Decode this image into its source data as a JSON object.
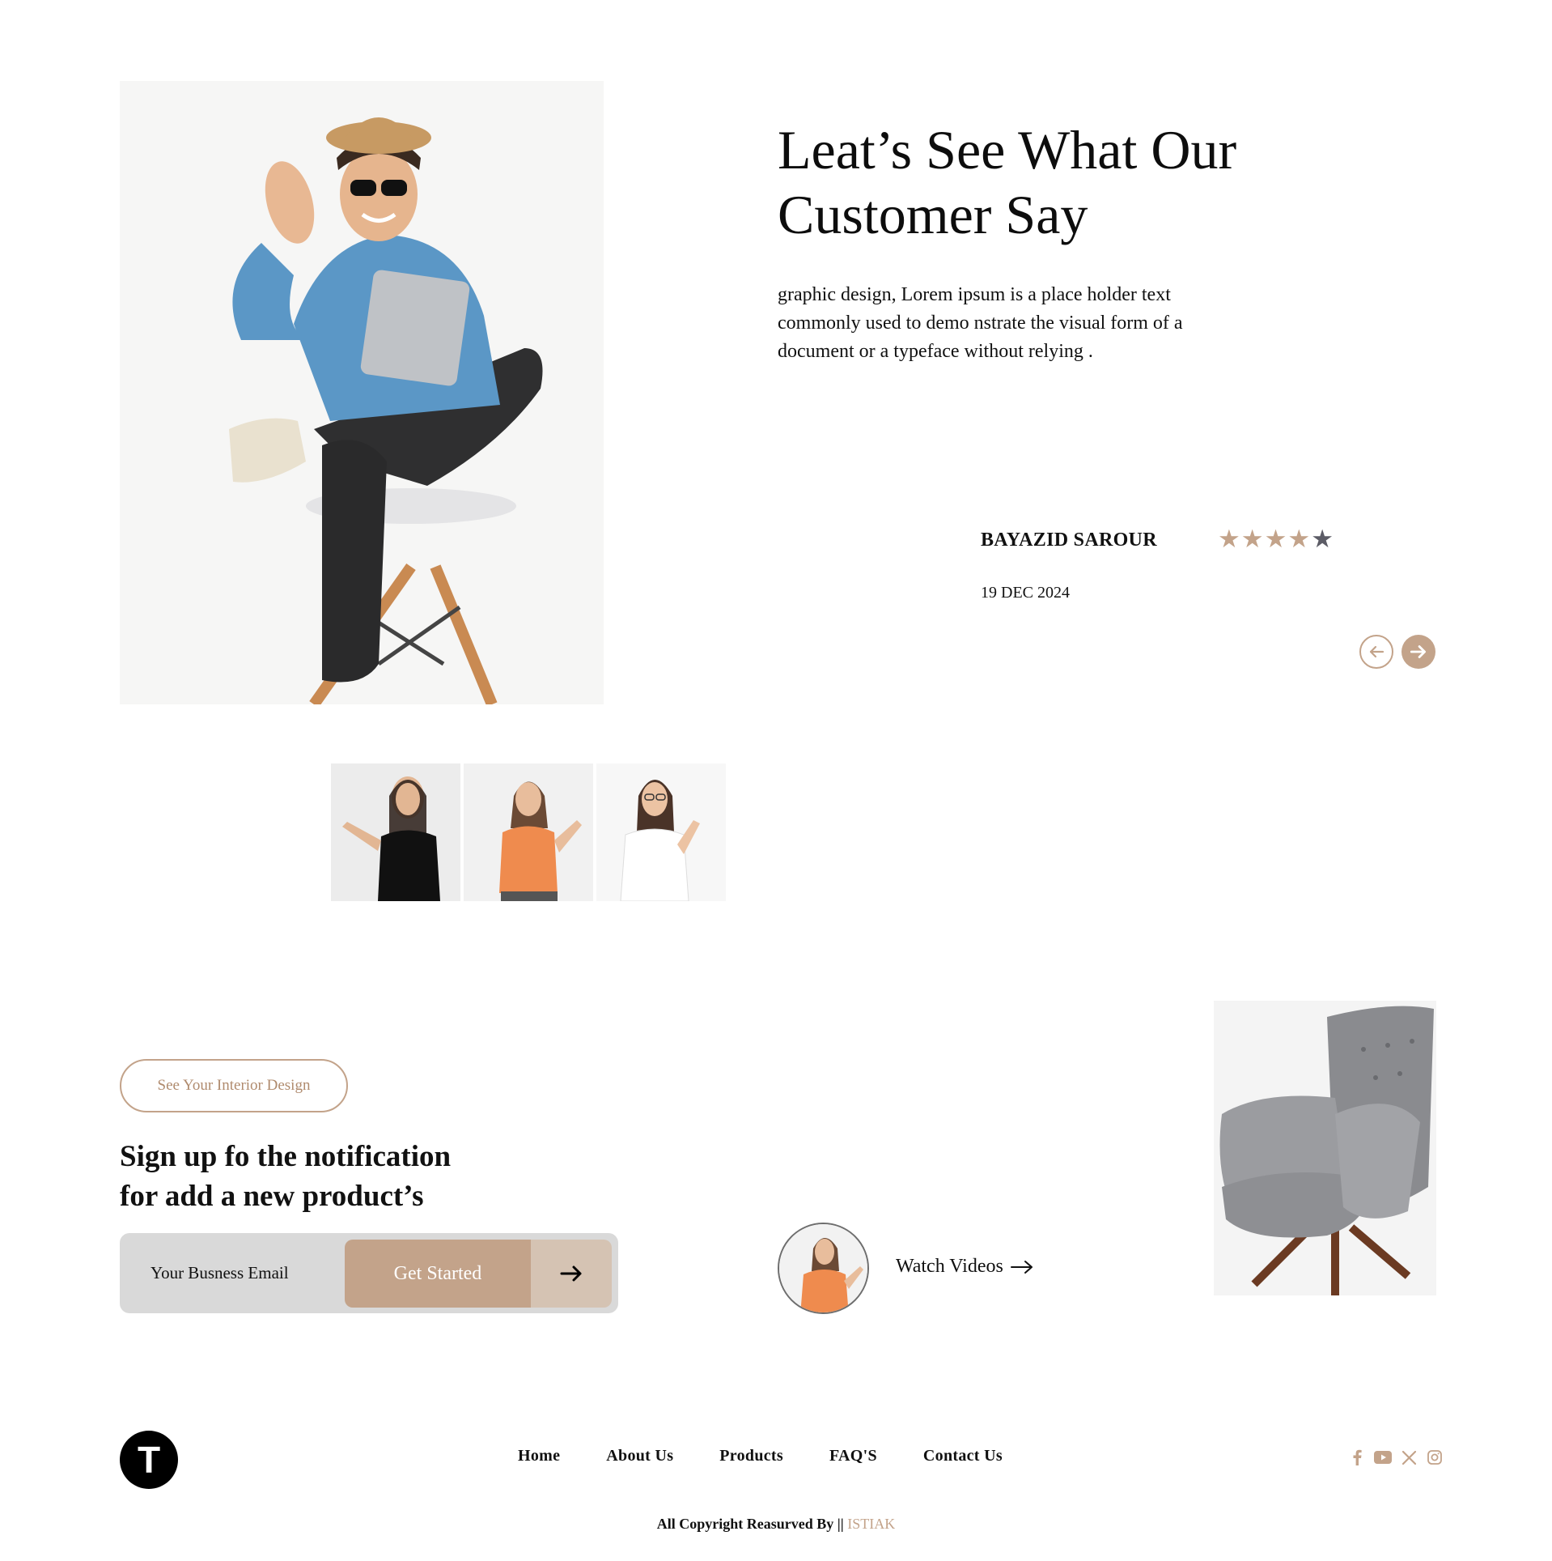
{
  "testimonial": {
    "heading_line1": "Leat’s See What Our",
    "heading_line2": "Customer Say",
    "intro": "graphic design, Lorem ipsum is a place holder text commonly used to demo nstrate the visual form of a document or a typeface without relying .",
    "reviewer_name": "BAYAZID SAROUR",
    "rating": 4,
    "rating_max": 5,
    "date": "19 DEC 2024",
    "star_glyph": "★",
    "star_color_filled": "#c3a38a",
    "star_color_empty": "#5c5c66"
  },
  "signup": {
    "pill_label": "See Your Interior Design",
    "title_line1": "Sign up fo the notification",
    "title_line2": "for add a new product’s",
    "email_placeholder": "Your Busness Email",
    "cta_label": "Get Started"
  },
  "video": {
    "label": "Watch Videos"
  },
  "footer": {
    "logo_letter": "T",
    "nav": [
      "Home",
      "About Us",
      "Products",
      "FAQ'S",
      "Contact Us"
    ],
    "social_icons": [
      "facebook-icon",
      "youtube-icon",
      "x-icon",
      "instagram-icon"
    ],
    "copyright_prefix": "All Copyright Reasurved By ||",
    "copyright_brand": "ISTIAK"
  },
  "colors": {
    "accent": "#c3a38a",
    "accent_light": "#d5c3b3",
    "input_bg": "#d9d9d9"
  }
}
